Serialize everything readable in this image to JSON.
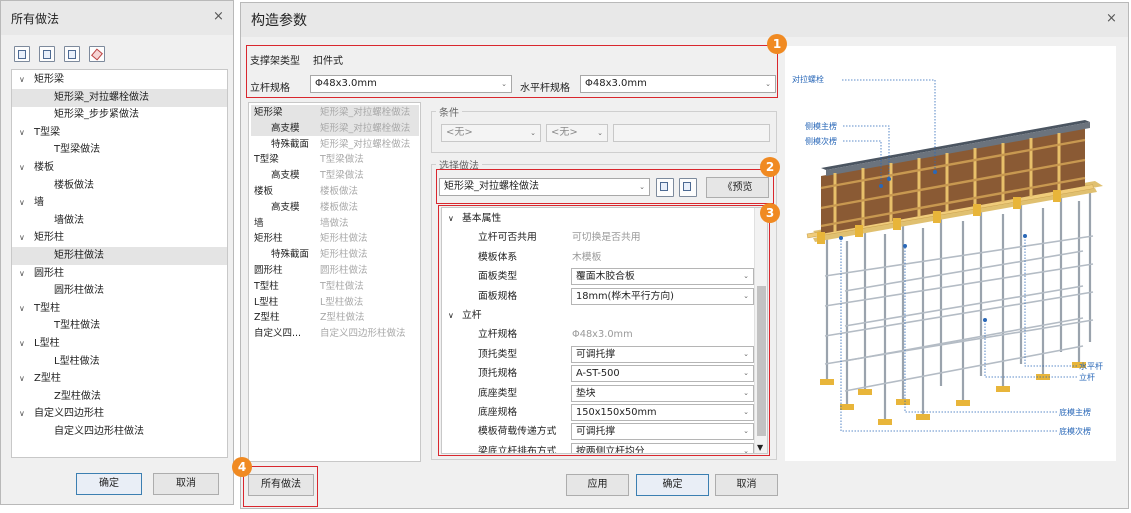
{
  "left_dialog": {
    "title": "所有做法",
    "close": "×",
    "ok": "确定",
    "cancel": "取消",
    "tree": [
      {
        "label": "矩形梁",
        "level": 0
      },
      {
        "label": "矩形梁_对拉螺栓做法",
        "level": 1,
        "selected": true
      },
      {
        "label": "矩形梁_步步紧做法",
        "level": 1
      },
      {
        "label": "T型梁",
        "level": 0
      },
      {
        "label": "T型梁做法",
        "level": 1
      },
      {
        "label": "楼板",
        "level": 0
      },
      {
        "label": "楼板做法",
        "level": 1
      },
      {
        "label": "墙",
        "level": 0
      },
      {
        "label": "墙做法",
        "level": 1
      },
      {
        "label": "矩形柱",
        "level": 0
      },
      {
        "label": "矩形柱做法",
        "level": 1,
        "selected": true
      },
      {
        "label": "圆形柱",
        "level": 0
      },
      {
        "label": "圆形柱做法",
        "level": 1
      },
      {
        "label": "T型柱",
        "level": 0
      },
      {
        "label": "T型柱做法",
        "level": 1
      },
      {
        "label": "L型柱",
        "level": 0
      },
      {
        "label": "L型柱做法",
        "level": 1
      },
      {
        "label": "Z型柱",
        "level": 0
      },
      {
        "label": "Z型柱做法",
        "level": 1
      },
      {
        "label": "自定义四边形柱",
        "level": 0
      },
      {
        "label": "自定义四边形柱做法",
        "level": 1
      }
    ]
  },
  "main_dialog": {
    "title": "构造参数",
    "close": "×",
    "support_type_label": "支撑架类型",
    "support_type_value": "扣件式",
    "pole_spec_label": "立杆规格",
    "pole_spec_value": "Φ48x3.0mm",
    "hbar_spec_label": "水平杆规格",
    "hbar_spec_value": "Φ48x3.0mm",
    "component_list": [
      {
        "a": "矩形梁",
        "b": "矩形梁_对拉螺栓做法",
        "indent": 0,
        "selected": true
      },
      {
        "a": "高支模",
        "b": "矩形梁_对拉螺栓做法",
        "indent": 1,
        "selected": true
      },
      {
        "a": "特殊截面",
        "b": "矩形梁_对拉螺栓做法",
        "indent": 1
      },
      {
        "a": "T型梁",
        "b": "T型梁做法",
        "indent": 0
      },
      {
        "a": "高支模",
        "b": "T型梁做法",
        "indent": 1
      },
      {
        "a": "楼板",
        "b": "楼板做法",
        "indent": 0
      },
      {
        "a": "高支模",
        "b": "楼板做法",
        "indent": 1
      },
      {
        "a": "墙",
        "b": "墙做法",
        "indent": 0
      },
      {
        "a": "矩形柱",
        "b": "矩形柱做法",
        "indent": 0
      },
      {
        "a": "特殊截面",
        "b": "矩形柱做法",
        "indent": 1
      },
      {
        "a": "圆形柱",
        "b": "圆形柱做法",
        "indent": 0
      },
      {
        "a": "T型柱",
        "b": "T型柱做法",
        "indent": 0
      },
      {
        "a": "L型柱",
        "b": "L型柱做法",
        "indent": 0
      },
      {
        "a": "Z型柱",
        "b": "Z型柱做法",
        "indent": 0
      },
      {
        "a": "自定义四...",
        "b": "自定义四边形柱做法",
        "indent": 0
      }
    ],
    "condition_label": "条件",
    "cond1": "<无>",
    "cond2": "<无>",
    "method_label": "选择做法",
    "method_value": "矩形梁_对拉螺栓做法",
    "preview": "《预览",
    "props": [
      {
        "type": "group",
        "label": "基本属性"
      },
      {
        "type": "text",
        "label": "立杆可否共用",
        "value": "可切换是否共用"
      },
      {
        "type": "text",
        "label": "模板体系",
        "value": "木模板"
      },
      {
        "type": "select",
        "label": "面板类型",
        "value": "覆面木胶合板"
      },
      {
        "type": "select",
        "label": "面板规格",
        "value": "18mm(桦木平行方向)"
      },
      {
        "type": "group",
        "label": "立杆"
      },
      {
        "type": "text",
        "label": "立杆规格",
        "value": "Φ48x3.0mm"
      },
      {
        "type": "select",
        "label": "顶托类型",
        "value": "可调托撑"
      },
      {
        "type": "select",
        "label": "顶托规格",
        "value": "A-ST-500"
      },
      {
        "type": "select",
        "label": "底座类型",
        "value": "垫块"
      },
      {
        "type": "select",
        "label": "底座规格",
        "value": "150x150x50mm"
      },
      {
        "type": "select",
        "label": "模板荷载传递方式",
        "value": "可调托撑"
      },
      {
        "type": "select",
        "label": "梁底立杆排布方式",
        "value": "按两侧立杆均分"
      }
    ],
    "all_methods": "所有做法",
    "apply": "应用",
    "ok": "确定",
    "cancel": "取消",
    "callouts": {
      "c1": "对拉螺栓",
      "c2": "侧模主楞",
      "c3": "侧模次楞",
      "c4": "水平杆",
      "c5": "立杆",
      "c6": "底模主楞",
      "c7": "底模次楞"
    },
    "badges": {
      "b1": "1",
      "b2": "2",
      "b3": "3",
      "b4": "4"
    }
  },
  "colors": {
    "highlight": "#d9272e",
    "badge": "#f08a22",
    "callout": "#2a68b8"
  }
}
